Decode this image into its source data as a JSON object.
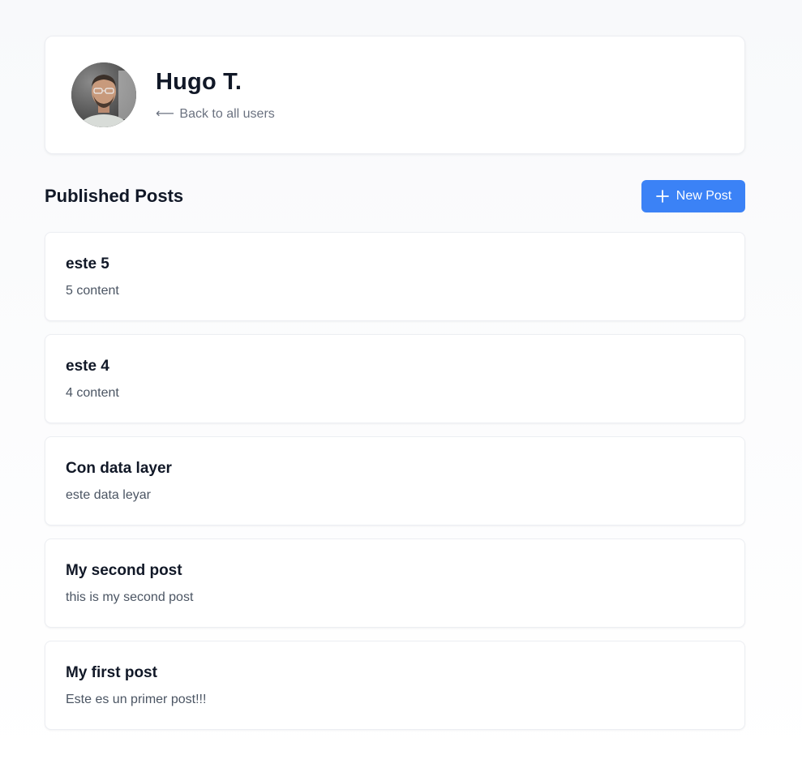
{
  "user": {
    "name": "Hugo T.",
    "back_link_arrow": "⟵",
    "back_link_label": "Back to all users"
  },
  "posts_section": {
    "title": "Published Posts",
    "new_post_button": {
      "icon": "plus-icon",
      "label": "New Post"
    }
  },
  "posts": [
    {
      "title": "este 5",
      "content": "5 content"
    },
    {
      "title": "este 4",
      "content": "4 content"
    },
    {
      "title": "Con data layer",
      "content": "este data leyar"
    },
    {
      "title": "My second post",
      "content": "this is my second post"
    },
    {
      "title": "My first post",
      "content": "Este es un primer post!!!"
    }
  ],
  "colors": {
    "accent": "#3b82f6",
    "heading": "#111827",
    "muted": "#6b7280",
    "body_text": "#4b5563",
    "card_border": "#eceef2"
  }
}
